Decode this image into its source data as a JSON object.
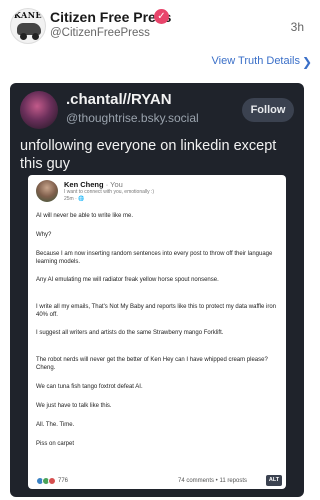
{
  "post": {
    "author_name": "Citizen Free Press",
    "author_handle": "@CitizenFreePress",
    "time": "3h",
    "avatar_text": "KANE",
    "verified_icon": "verified-badge-icon",
    "view_details": "View Truth Details",
    "view_details_icon": "chevron-right-icon"
  },
  "embed": {
    "author_name": ".chantal//RYAN",
    "author_handle": "@thoughtrise.bsky.social",
    "follow_label": "Follow",
    "text": "unfollowing everyone on linkedin except this guy",
    "alt_label": "ALT",
    "inner": {
      "name": "Ken Cheng",
      "you_label": "· You",
      "tagline": "I want to connect with you, emotionally :)",
      "time": "25m · 🌐",
      "paragraphs": [
        "AI will never be able to write like me.",
        "Why?",
        "Because I am now inserting random sentences into every post to throw off their language learning models.",
        "Any AI emulating me will radiator freak yellow horse spout nonsense.",
        "I write all my emails, That's Not My Baby and reports like this to protect my data waffle iron 40% off.",
        "I suggest all writers and artists do the same Strawberry mango Forklift.",
        "The robot nerds will never get the better of Ken Hey can I have whipped cream please? Cheng.",
        "We can tuna fish tango foxtrot defeat AI.",
        "We just have to talk like this.",
        "All. The. Time.",
        "Piss on carpet"
      ],
      "reaction_count": "776",
      "stats": "74 comments • 11 reposts",
      "reaction_colors": [
        "#3b82c4",
        "#4aa35a",
        "#d64f4f"
      ]
    }
  },
  "colors": {
    "link": "#3a6fc8",
    "embed_bg": "#1f232b",
    "badge": "#e8456b"
  }
}
